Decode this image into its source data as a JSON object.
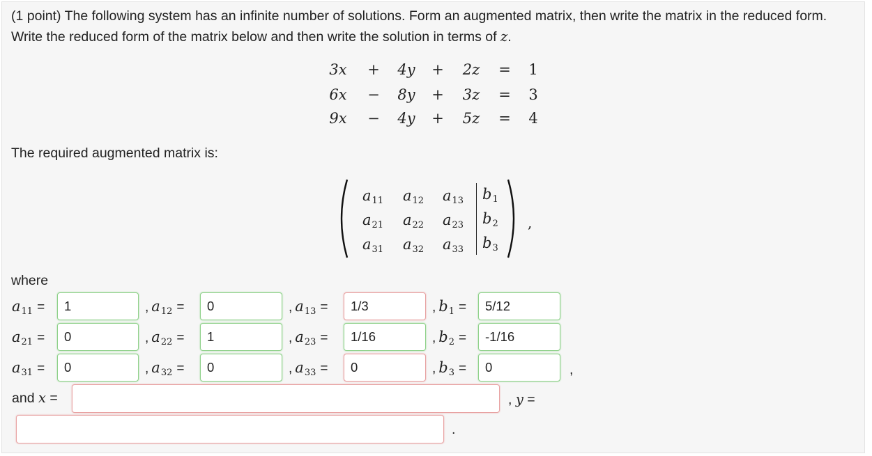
{
  "problem": {
    "intro": "(1 point) The following system has an infinite number of solutions. Form an augmented matrix, then write the matrix in the reduced form. Write the reduced form of the matrix below and then write the solution in terms of",
    "intro_var": "z",
    "intro_end": "."
  },
  "system": [
    [
      "3x",
      "+",
      "4y",
      "+",
      "2z",
      "=",
      "1"
    ],
    [
      "6x",
      "−",
      "8y",
      "+",
      "3z",
      "=",
      "3"
    ],
    [
      "9x",
      "−",
      "4y",
      "+",
      "5z",
      "=",
      "4"
    ]
  ],
  "required_label": "The required augmented matrix is:",
  "matrix": {
    "rows": [
      {
        "a": [
          "a",
          "a",
          "a"
        ],
        "subs": [
          "11",
          "12",
          "13"
        ],
        "b": "b",
        "bsub": "1"
      },
      {
        "a": [
          "a",
          "a",
          "a"
        ],
        "subs": [
          "21",
          "22",
          "23"
        ],
        "b": "b",
        "bsub": "2"
      },
      {
        "a": [
          "a",
          "a",
          "a"
        ],
        "subs": [
          "31",
          "32",
          "33"
        ],
        "b": "b",
        "bsub": "3"
      }
    ],
    "trailing": ","
  },
  "where_label": "where",
  "answers": {
    "a11": {
      "value": "1",
      "status": "ok"
    },
    "a12": {
      "value": "0",
      "status": "ok"
    },
    "a13": {
      "value": "1/3",
      "status": "bad"
    },
    "b1": {
      "value": "5/12",
      "status": "ok"
    },
    "a21": {
      "value": "0",
      "status": "ok"
    },
    "a22": {
      "value": "1",
      "status": "ok"
    },
    "a23": {
      "value": "1/16",
      "status": "ok"
    },
    "b2": {
      "value": "-1/16",
      "status": "ok"
    },
    "a31": {
      "value": "0",
      "status": "ok"
    },
    "a32": {
      "value": "0",
      "status": "ok"
    },
    "a33": {
      "value": "0",
      "status": "bad"
    },
    "b3": {
      "value": "0",
      "status": "ok"
    },
    "x": {
      "value": "",
      "status": "bad"
    },
    "y": {
      "value": "",
      "status": "bad"
    }
  },
  "row_end_comma": ",",
  "and_label": "and",
  "x_var": "x",
  "y_var": "y",
  "equals": "=",
  "final_period": "."
}
